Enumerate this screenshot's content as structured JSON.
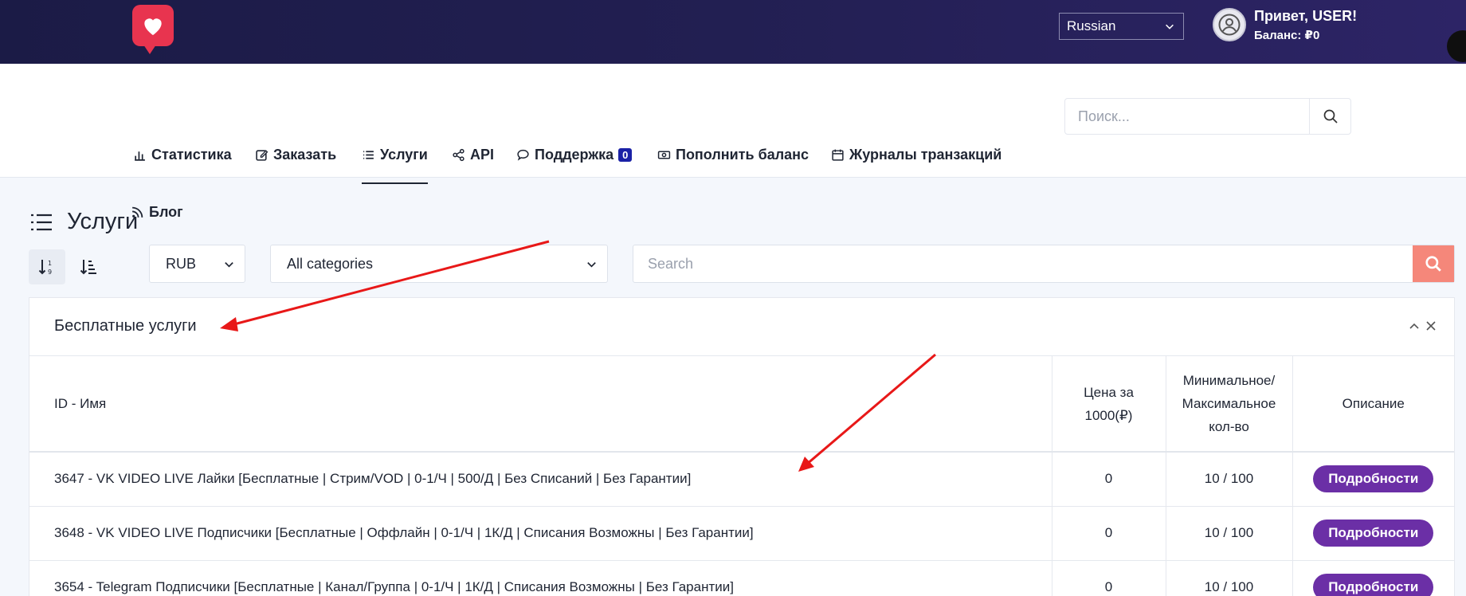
{
  "header": {
    "language": "Russian",
    "greeting": "Привет, USER!",
    "balance": "Баланс: ₽0"
  },
  "nav": {
    "items": [
      {
        "label": "Статистика",
        "icon": "bar-chart-icon"
      },
      {
        "label": "Заказать",
        "icon": "edit-icon"
      },
      {
        "label": "Услуги",
        "icon": "list-icon",
        "active": true
      },
      {
        "label": "API",
        "icon": "share-icon"
      },
      {
        "label": "Поддержка",
        "icon": "chat-icon",
        "badge": "0"
      },
      {
        "label": "Пополнить баланс",
        "icon": "money-icon"
      },
      {
        "label": "Журналы транзакций",
        "icon": "calendar-icon"
      },
      {
        "label": "Блог",
        "icon": "rss-icon"
      }
    ],
    "search_placeholder": "Поиск..."
  },
  "page": {
    "title": "Услуги",
    "currency": "RUB",
    "category": "All categories",
    "search_placeholder": "Search"
  },
  "card": {
    "title": "Бесплатные услуги",
    "columns": {
      "name": "ID - Имя",
      "price_line1": "Цена за",
      "price_line2": "1000(₽)",
      "minmax_line1": "Минимальное/",
      "minmax_line2": "Максимальное",
      "minmax_line3": "кол-во",
      "desc": "Описание"
    },
    "rows": [
      {
        "name": "3647 - VK VIDEO LIVE Лайки [Бесплатные | Стрим/VOD | 0-1/Ч | 500/Д | Без Списаний | Без Гарантии]",
        "price": "0",
        "minmax": "10 / 100",
        "button": "Подробности"
      },
      {
        "name": "3648 - VK VIDEO LIVE Подписчики [Бесплатные | Оффлайн | 0-1/Ч | 1К/Д | Списания Возможны | Без Гарантии]",
        "price": "0",
        "minmax": "10 / 100",
        "button": "Подробности"
      },
      {
        "name": "3654 - Telegram Подписчики [Бесплатные | Канал/Группа | 0-1/Ч | 1К/Д | Списания Возможны | Без Гарантии]",
        "price": "0",
        "minmax": "10 / 100",
        "button": "Подробности"
      }
    ]
  },
  "colors": {
    "topbar": "#1b1b46",
    "logo": "#e8344f",
    "badge": "#1a21a6",
    "details_button": "#6b2fa6",
    "search_button": "#f5877a",
    "arrow": "#e81818"
  }
}
